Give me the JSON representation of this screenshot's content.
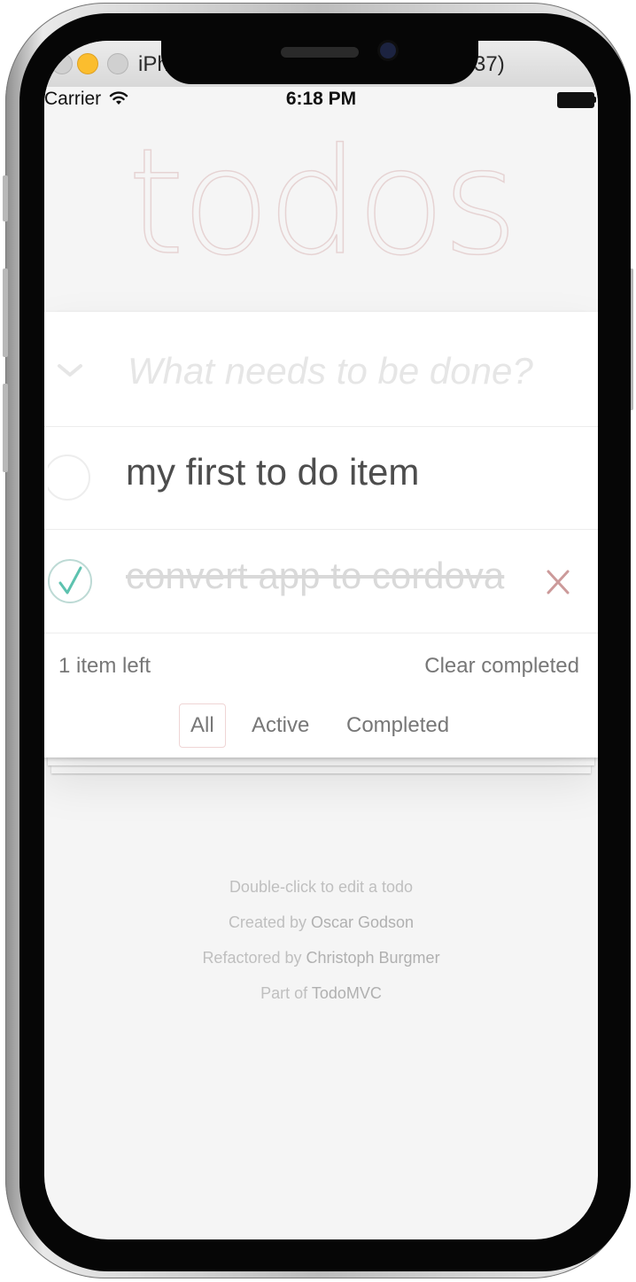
{
  "window": {
    "title_left": "iPh",
    "title_right": "37)"
  },
  "status_bar": {
    "carrier": "Carrier",
    "time": "6:18 PM"
  },
  "app": {
    "title": "todos"
  },
  "new_todo": {
    "placeholder": "What needs to be done?",
    "value": ""
  },
  "todos": [
    {
      "label": "my first to do item",
      "completed": false
    },
    {
      "label": "convert app to cordova",
      "completed": true
    }
  ],
  "footer": {
    "count": "1 item left",
    "clear_completed": "Clear completed",
    "filters": [
      {
        "label": "All",
        "selected": true
      },
      {
        "label": "Active",
        "selected": false
      },
      {
        "label": "Completed",
        "selected": false
      }
    ]
  },
  "info": {
    "edit_hint": "Double-click to edit a todo",
    "created_prefix": "Created by ",
    "created_name": "Oscar Godson",
    "refactored_prefix": "Refactored by ",
    "refactored_name": "Christoph Burgmer",
    "part_prefix": "Part of ",
    "part_name": "TodoMVC"
  },
  "colors": {
    "title": "#ead7d7",
    "checkmark": "#5dc2af",
    "destroy": "#cc9a9a",
    "text": "#4d4d4d",
    "completed_text": "#d9d9d9"
  },
  "icons": {
    "wifi": "wifi-icon",
    "battery": "battery-icon",
    "toggle_all": "chevron-down-icon",
    "unchecked": "empty-circle-icon",
    "checked": "check-circle-icon",
    "destroy": "close-x-icon"
  }
}
